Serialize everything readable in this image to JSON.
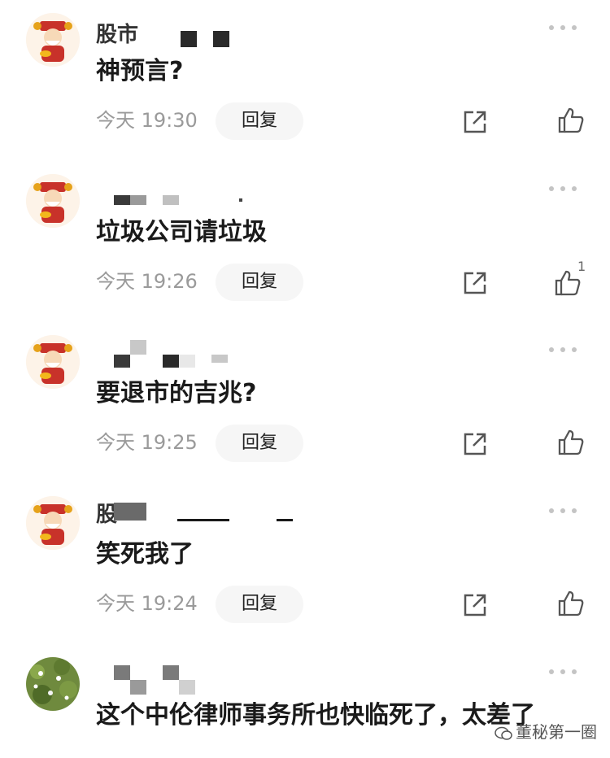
{
  "comments": [
    {
      "username": "股市",
      "text": "神预言?",
      "time": "今天 19:30",
      "reply_label": "回复",
      "likes": ""
    },
    {
      "username": "",
      "text": "垃圾公司请垃圾",
      "time": "今天 19:26",
      "reply_label": "回复",
      "likes": "1"
    },
    {
      "username": "",
      "text": "要退市的吉兆?",
      "time": "今天 19:25",
      "reply_label": "回复",
      "likes": ""
    },
    {
      "username": "股",
      "text": "笑死我了",
      "time": "今天 19:24",
      "reply_label": "回复",
      "likes": ""
    },
    {
      "username": "",
      "text": "这个中伦律师事务所也快临死了，太差了",
      "time": "",
      "reply_label": "",
      "likes": ""
    }
  ],
  "watermark": "董秘第一圈",
  "icons": {
    "more": "more-dots-icon",
    "share": "share-icon",
    "like": "thumbs-up-icon"
  },
  "colors": {
    "time": "#9a9a9a",
    "reply_bg": "#f6f6f6",
    "icon": "#555555"
  }
}
